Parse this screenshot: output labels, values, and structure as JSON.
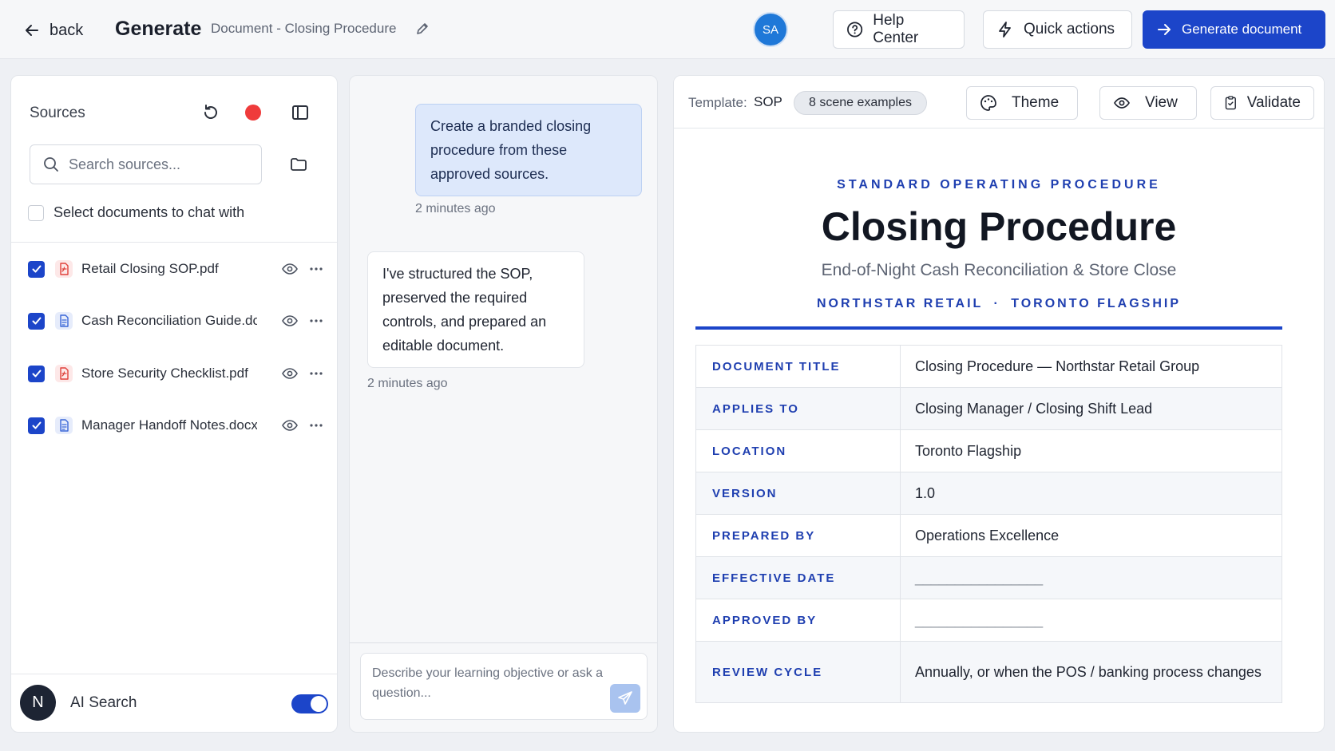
{
  "header": {
    "back_label": "back",
    "page_title": "Generate",
    "doc_name": "Document - Closing Procedure",
    "avatar_initials": "SA",
    "help_label": "Help Center",
    "quick_label": "Quick actions",
    "generate_label": "Generate document"
  },
  "sources": {
    "title": "Sources",
    "search_placeholder": "Search sources...",
    "select_all_label": "Select documents to chat with",
    "files": [
      {
        "name": "Retail Closing SOP.pdf",
        "type": "pdf",
        "checked": true
      },
      {
        "name": "Cash Reconciliation Guide.docx",
        "type": "docx",
        "checked": true
      },
      {
        "name": "Store Security Checklist.pdf",
        "type": "pdf",
        "checked": true
      },
      {
        "name": "Manager Handoff Notes.docx",
        "type": "docx",
        "checked": true
      }
    ],
    "ai_avatar": "N",
    "ai_label": "AI Search",
    "ai_enabled": true
  },
  "chat": {
    "messages": [
      {
        "role": "user",
        "text": "Create a branded closing procedure from these approved sources.",
        "time": "2 minutes ago"
      },
      {
        "role": "assistant",
        "text": "I've structured the SOP, preserved the required controls, and prepared an editable document.",
        "time": "2 minutes ago"
      }
    ],
    "input_placeholder": "Describe your learning objective or ask a question..."
  },
  "document": {
    "template_label": "Template:",
    "template_value": "SOP",
    "examples_pill": "8 scene examples",
    "theme_label": "Theme",
    "view_label": "View",
    "validate_label": "Validate",
    "kicker": "STANDARD OPERATING PROCEDURE",
    "title": "Closing Procedure",
    "subtitle": "End-of-Night Cash Reconciliation & Store Close",
    "org_left": "NORTHSTAR RETAIL",
    "org_sep": "·",
    "org_right": "TORONTO FLAGSHIP",
    "accent_color": "#1c45c9",
    "meta": [
      {
        "key": "DOCUMENT TITLE",
        "value": "Closing Procedure — Northstar Retail Group"
      },
      {
        "key": "APPLIES TO",
        "value": "Closing Manager / Closing Shift Lead"
      },
      {
        "key": "LOCATION",
        "value": "Toronto Flagship"
      },
      {
        "key": "VERSION",
        "value": "1.0"
      },
      {
        "key": "PREPARED BY",
        "value": "Operations Excellence"
      },
      {
        "key": "EFFECTIVE DATE",
        "value": "________________"
      },
      {
        "key": "APPROVED BY",
        "value": "________________"
      },
      {
        "key": "REVIEW CYCLE",
        "value": "Annually, or when the POS / banking process changes"
      }
    ]
  }
}
